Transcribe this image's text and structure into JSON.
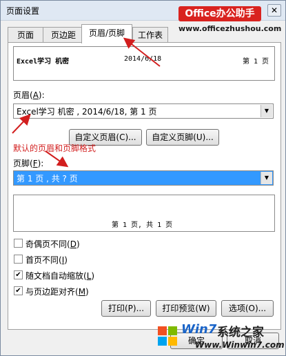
{
  "window": {
    "title": "页面设置",
    "close": "✕"
  },
  "watermark": {
    "brand": "Office办公助手",
    "brand_url": "www.officezhushou.com",
    "win7_text": "Win7",
    "win7_cn": "系统之家",
    "win7_url": "Www.Winwin7.com"
  },
  "tabs": [
    {
      "label": "页面",
      "active": false
    },
    {
      "label": "页边距",
      "active": false
    },
    {
      "label": "页眉/页脚",
      "active": true
    },
    {
      "label": "工作表",
      "active": false
    }
  ],
  "header_preview": {
    "left": "Excel学习  机密",
    "center": "2014/6/18",
    "right": "第 1 页"
  },
  "header": {
    "label": "页眉(",
    "hotkey": "A",
    "label_end": "):",
    "value": "Excel学习  机密 , 2014/6/18,  第 1 页"
  },
  "buttons": {
    "custom_header": "自定义页眉(C)...",
    "custom_footer": "自定义页脚(U)...",
    "print": "打印(P)...",
    "print_preview": "打印预览(W)",
    "options": "选项(O)...",
    "ok": "确定",
    "cancel": "取消"
  },
  "annotation": "默认的页眉和页脚格式",
  "footer": {
    "label": "页脚(",
    "hotkey": "F",
    "label_end": "):",
    "value": "第 1 页 , 共 ? 页"
  },
  "footer_preview": {
    "center": "第 1 页, 共 1 页"
  },
  "checkboxes": [
    {
      "label": "奇偶页不同(",
      "hotkey": "D",
      "end": ")",
      "checked": false
    },
    {
      "label": "首页不同(",
      "hotkey": "I",
      "end": ")",
      "checked": false
    },
    {
      "label": "随文档自动缩放(",
      "hotkey": "L",
      "end": ")",
      "checked": true
    },
    {
      "label": "与页边距对齐(",
      "hotkey": "M",
      "end": ")",
      "checked": true
    }
  ],
  "colors": {
    "accent": "#d21e1e",
    "selection": "#3399ff"
  }
}
